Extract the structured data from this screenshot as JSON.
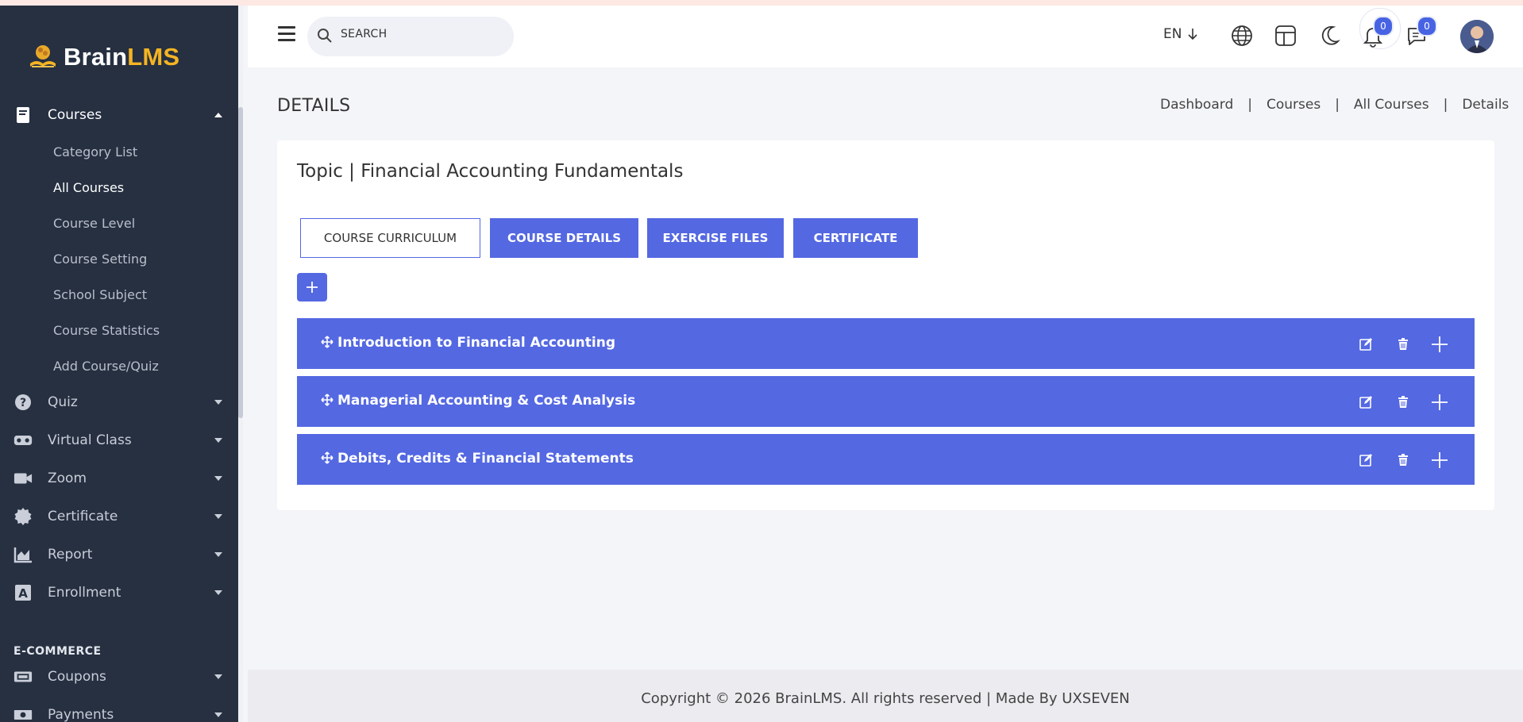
{
  "brand": {
    "name_part1": "Brain",
    "name_part2": "LMS"
  },
  "sidebar": {
    "courses": {
      "label": "Courses"
    },
    "submenu": [
      {
        "label": "Category List"
      },
      {
        "label": "All Courses"
      },
      {
        "label": "Course Level"
      },
      {
        "label": "Course Setting"
      },
      {
        "label": "School Subject"
      },
      {
        "label": "Course Statistics"
      },
      {
        "label": "Add Course/Quiz"
      }
    ],
    "items": [
      {
        "label": "Quiz"
      },
      {
        "label": "Virtual Class"
      },
      {
        "label": "Zoom"
      },
      {
        "label": "Certificate"
      },
      {
        "label": "Report"
      },
      {
        "label": "Enrollment"
      }
    ],
    "section_ecommerce": "E-COMMERCE",
    "ecommerce_items": [
      {
        "label": "Coupons"
      },
      {
        "label": "Payments"
      }
    ]
  },
  "header": {
    "search_placeholder": "SEARCH",
    "language": "EN",
    "notifications_count": "0",
    "messages_count": "0"
  },
  "page": {
    "title": "DETAILS",
    "breadcrumb": [
      "Dashboard",
      "Courses",
      "All Courses",
      "Details"
    ],
    "breadcrumb_sep": "|"
  },
  "card": {
    "title": "Topic | Financial Accounting Fundamentals",
    "tabs": [
      {
        "label": "COURSE CURRICULUM"
      },
      {
        "label": "COURSE DETAILS"
      },
      {
        "label": "EXERCISE FILES"
      },
      {
        "label": "CERTIFICATE"
      }
    ],
    "topics": [
      {
        "title": "Introduction to Financial Accounting"
      },
      {
        "title": "Managerial Accounting & Cost Analysis"
      },
      {
        "title": "Debits, Credits & Financial Statements"
      }
    ]
  },
  "footer": {
    "text": "Copyright © 2026 BrainLMS. All rights reserved | Made By UXSEVEN"
  },
  "colors": {
    "sidebar_bg": "#263041",
    "accent": "#5468e2",
    "logo_accent": "#f4b423"
  }
}
